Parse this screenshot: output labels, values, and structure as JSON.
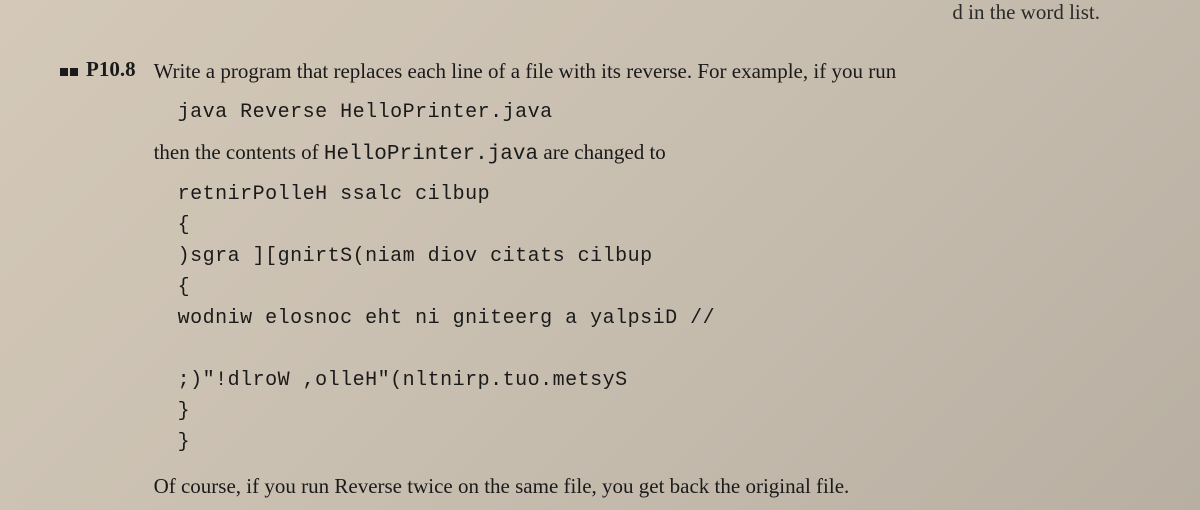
{
  "partial_top": "d in the word list.",
  "exercise": {
    "number": "P10.8",
    "line1": "Write a program that replaces each line of a file with its reverse. For example, if you run",
    "code1": "java Reverse HelloPrinter.java",
    "line2_a": "then the contents of ",
    "line2_code": "HelloPrinter.java",
    "line2_b": " are changed to",
    "code2": "retnirPolleH ssalc cilbup\n{\n)sgra ][gnirtS(niam diov citats cilbup\n{\nwodniw elosnoc eht ni gniteerg a yalpsiD //\n\n;)\"!dlroW ,olleH\"(nltnirp.tuo.metsyS\n}\n}",
    "closing": "Of course, if you run Reverse twice on the same file, you get back the original file."
  }
}
